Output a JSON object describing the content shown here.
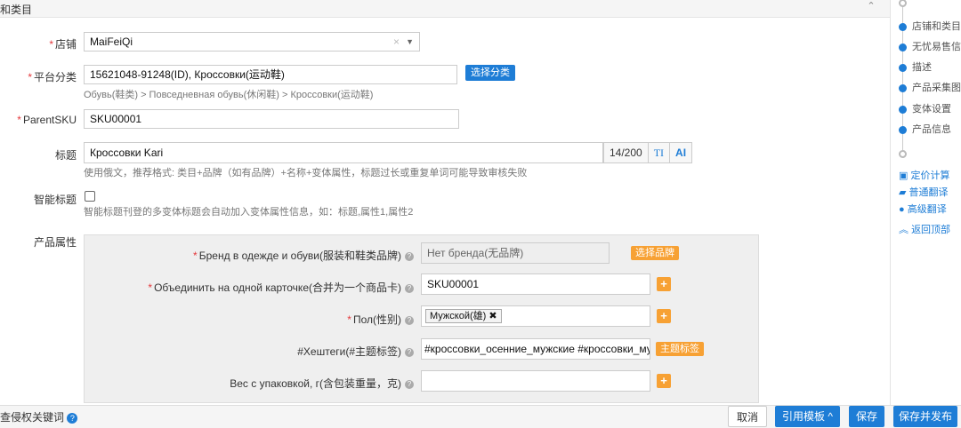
{
  "section": {
    "title": "和类目",
    "collapse_icon": "chevron-up-icon"
  },
  "store": {
    "label": "店铺",
    "value": "MaiFeiQi"
  },
  "category": {
    "label": "平台分类",
    "value": "15621048-91248(ID), Кроссовки(运动鞋)",
    "button": "选择分类",
    "path": "Обувь(鞋类) > Повседневная обувь(休闲鞋) > Кроссовки(运动鞋)"
  },
  "parent_sku": {
    "label": "ParentSKU",
    "value": "SKU00001"
  },
  "title": {
    "label": "标题",
    "value": "Кроссовки Kari",
    "counter": "14/200",
    "format_btn": "TI",
    "ai_btn": "AI",
    "hint": "使用俄文，推荐格式: 类目+品牌（如有品牌）+名称+变体属性，标题过长或重复单词可能导致审核失败"
  },
  "smart_title": {
    "label": "智能标题",
    "hint": "智能标题刊登的多变体标题会自动加入变体属性信息，如：标题,属性1,属性2"
  },
  "attributes": {
    "label": "产品属性",
    "items": [
      {
        "label": "Бренд в одежде и обуви(服装和鞋类品牌)",
        "value": "Нет бренда(无品牌)",
        "button": "选择品牌"
      },
      {
        "label": "Объединить на одной карточке(合并为一个商品卡)",
        "value": "SKU00001"
      },
      {
        "label": "Пол(性别)",
        "tag": "Мужской(雄)"
      },
      {
        "label": "#Хештеги(#主题标签)",
        "value": "#кроссовки_осенние_мужские #кроссовки_му",
        "button": "主题标签"
      },
      {
        "label": "Вес с упаковкой, г(含包装重量，克)",
        "value": ""
      }
    ]
  },
  "nav": {
    "items": [
      "店铺和类目",
      "无忧易售信息",
      "描述",
      "产品采集图",
      "变体设置",
      "产品信息"
    ],
    "tools": [
      "定价计算",
      "普通翻译",
      "高级翻译",
      "返回顶部"
    ]
  },
  "footer": {
    "left_text": "查侵权关键词",
    "cancel": "取消",
    "template": "引用模板",
    "save": "保存",
    "save_publish": "保存并发布"
  },
  "colors": {
    "accent": "#1e7dd6",
    "orange": "#f7a134",
    "required": "#e4393c"
  }
}
